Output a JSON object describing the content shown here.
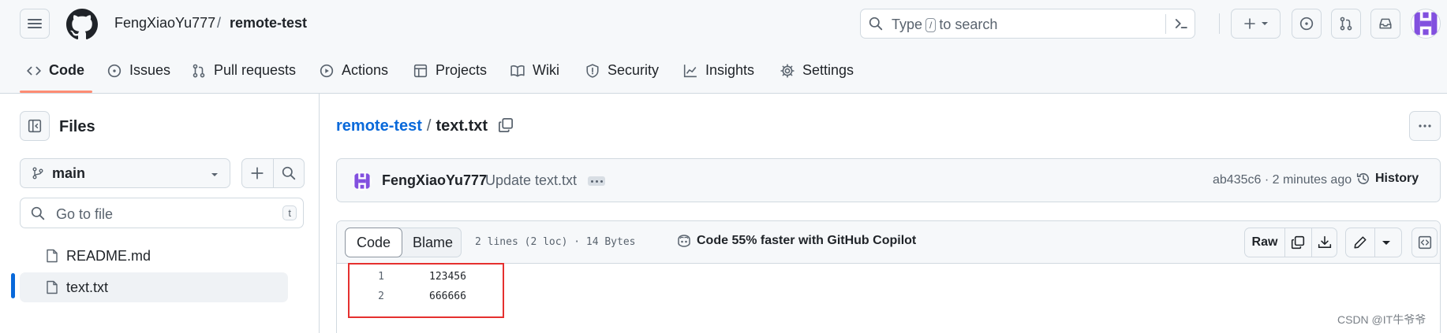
{
  "header": {
    "owner": "FengXiaoYu777",
    "separator": "/",
    "repo": "remote-test",
    "search": {
      "prefix": "Type",
      "key": "/",
      "suffix": "to search"
    }
  },
  "tabs": [
    {
      "label": "Code",
      "icon": "code-icon",
      "active": true
    },
    {
      "label": "Issues",
      "icon": "issue-opened-icon"
    },
    {
      "label": "Pull requests",
      "icon": "git-pull-request-icon"
    },
    {
      "label": "Actions",
      "icon": "play-icon"
    },
    {
      "label": "Projects",
      "icon": "table-icon"
    },
    {
      "label": "Wiki",
      "icon": "book-icon"
    },
    {
      "label": "Security",
      "icon": "shield-icon"
    },
    {
      "label": "Insights",
      "icon": "graph-icon"
    },
    {
      "label": "Settings",
      "icon": "gear-icon"
    }
  ],
  "sidebar": {
    "title": "Files",
    "branch": "main",
    "goto_placeholder": "Go to file",
    "goto_key": "t",
    "files": [
      {
        "name": "README.md",
        "selected": false
      },
      {
        "name": "text.txt",
        "selected": true
      }
    ]
  },
  "main": {
    "path_repo": "remote-test",
    "path_sep": "/",
    "path_file": "text.txt",
    "commit": {
      "author": "FengXiaoYu777",
      "message": "Update text.txt",
      "sha_time": "ab435c6 · 2 minutes ago",
      "history_label": "History"
    },
    "file": {
      "code_tab": "Code",
      "blame_tab": "Blame",
      "meta": "2 lines (2 loc) · 14 Bytes",
      "copilot": "Code 55% faster with GitHub Copilot",
      "raw_label": "Raw",
      "lines": [
        {
          "num": "1",
          "text": "123456"
        },
        {
          "num": "2",
          "text": "666666"
        }
      ]
    }
  },
  "colors": {
    "accent": "#0969da",
    "tab_underline": "#fd8c73",
    "highlight_box": "#e5302f",
    "avatar": "#8250df"
  },
  "watermark": "CSDN @IT牛爷爷"
}
